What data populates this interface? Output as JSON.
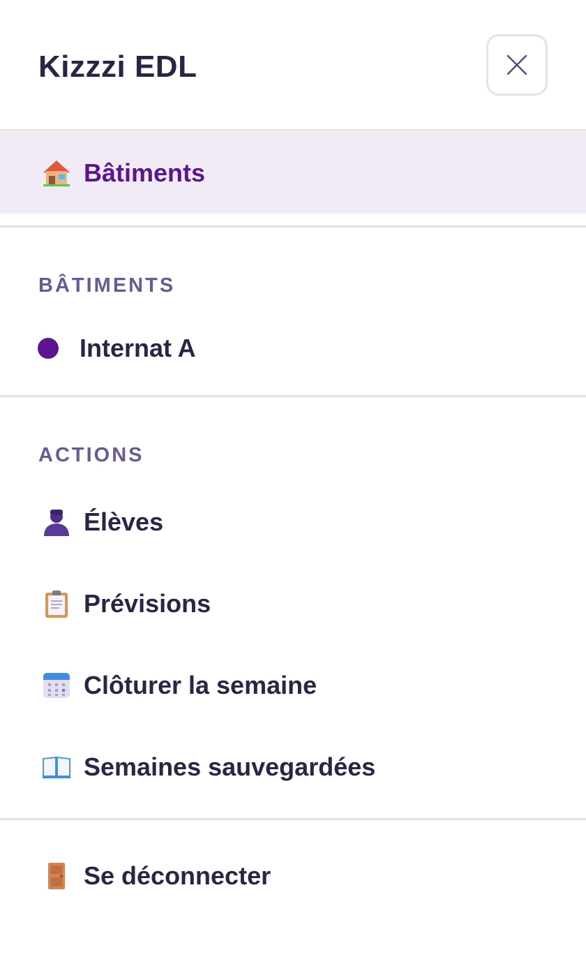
{
  "header": {
    "title": "Kizzzi EDL",
    "close_icon": "close-icon"
  },
  "nav": {
    "active_item": {
      "label": "Bâtiments",
      "icon": "house-icon"
    }
  },
  "buildings": {
    "section_title": "BÂTIMENTS",
    "items": [
      {
        "label": "Internat A",
        "dot_color": "#5b1592"
      }
    ]
  },
  "actions": {
    "section_title": "ACTIONS",
    "items": [
      {
        "label": "Élèves",
        "icon": "student-icon"
      },
      {
        "label": "Prévisions",
        "icon": "clipboard-icon"
      },
      {
        "label": "Clôturer la semaine",
        "icon": "calendar-icon"
      },
      {
        "label": "Semaines sauvegardées",
        "icon": "open-book-icon"
      }
    ]
  },
  "logout": {
    "label": "Se déconnecter",
    "icon": "door-icon"
  },
  "colors": {
    "accent": "#5b1592",
    "active_bg": "#f1ebf6",
    "text": "#2a2447",
    "section_title": "#6a5a93"
  }
}
